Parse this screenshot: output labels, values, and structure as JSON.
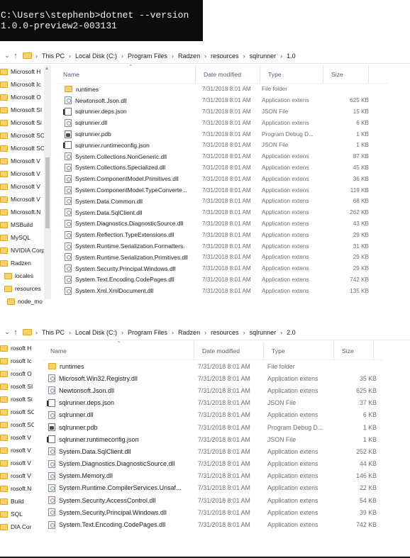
{
  "console": {
    "line1": "C:\\Users\\stephenb>dotnet --version",
    "line2": "1.0.0-preview2-003131"
  },
  "explorer1": {
    "breadcrumb": [
      "This PC",
      "Local Disk (C:)",
      "Program Files",
      "Radzen",
      "resources",
      "sqlrunner",
      "1.0"
    ],
    "nav": [
      "Microsoft H",
      "Microsoft Ic",
      "Microsoft O",
      "Microsoft SI",
      "Microsoft Si",
      "Microsoft SC",
      "Microsoft SC",
      "Microsoft V",
      "Microsoft V",
      "Microsoft V",
      "Microsoft V",
      "Microsoft.N",
      "MSBuild",
      "MySQL",
      "NVIDIA Corp",
      "Radzen",
      "locales",
      "resources",
      "node_mo"
    ],
    "columns": {
      "name": "Name",
      "date": "Date modified",
      "type": "Type",
      "size": "Size"
    },
    "files": [
      {
        "icon": "folder",
        "name": "runtimes",
        "date": "7/31/2018 8:01 AM",
        "type": "File folder",
        "size": ""
      },
      {
        "icon": "dll",
        "name": "Newtonsoft.Json.dll",
        "date": "7/31/2018 8:01 AM",
        "type": "Application extens",
        "size": "625 KB"
      },
      {
        "icon": "json",
        "name": "sqlrunner.deps.json",
        "date": "7/31/2018 8:01 AM",
        "type": "JSON File",
        "size": "15 KB"
      },
      {
        "icon": "dll",
        "name": "sqlrunner.dll",
        "date": "7/31/2018 8:01 AM",
        "type": "Application extens",
        "size": "6 KB"
      },
      {
        "icon": "pdb",
        "name": "sqlrunner.pdb",
        "date": "7/31/2018 8:01 AM",
        "type": "Program Debug D...",
        "size": "1 KB"
      },
      {
        "icon": "json",
        "name": "sqlrunner.runtimeconfig.json",
        "date": "7/31/2018 8:01 AM",
        "type": "JSON File",
        "size": "1 KB"
      },
      {
        "icon": "dll",
        "name": "System.Collections.NonGeneric.dll",
        "date": "7/31/2018 8:01 AM",
        "type": "Application extens",
        "size": "87 KB"
      },
      {
        "icon": "dll",
        "name": "System.Collections.Specialized.dll",
        "date": "7/31/2018 8:01 AM",
        "type": "Application extens",
        "size": "45 KB"
      },
      {
        "icon": "dll",
        "name": "System.ComponentModel.Primitives.dll",
        "date": "7/31/2018 8:01 AM",
        "type": "Application extens",
        "size": "36 KB"
      },
      {
        "icon": "dll",
        "name": "System.ComponentModel.TypeConverte...",
        "date": "7/31/2018 8:01 AM",
        "type": "Application extens",
        "size": "119 KB"
      },
      {
        "icon": "dll",
        "name": "System.Data.Common.dll",
        "date": "7/31/2018 8:01 AM",
        "type": "Application extens",
        "size": "68 KB"
      },
      {
        "icon": "dll",
        "name": "System.Data.SqlClient.dll",
        "date": "7/31/2018 8:01 AM",
        "type": "Application extens",
        "size": "262 KB"
      },
      {
        "icon": "dll",
        "name": "System.Diagnostics.DiagnosticSource.dll",
        "date": "7/31/2018 8:01 AM",
        "type": "Application extens",
        "size": "43 KB"
      },
      {
        "icon": "dll",
        "name": "System.Reflection.TypeExtensions.dll",
        "date": "7/31/2018 8:01 AM",
        "type": "Application extens",
        "size": "29 KB"
      },
      {
        "icon": "dll",
        "name": "System.Runtime.Serialization.Formatters.",
        "date": "7/31/2018 8:01 AM",
        "type": "Application extens",
        "size": "31 KB"
      },
      {
        "icon": "dll",
        "name": "System.Runtime.Serialization.Primitives.dll",
        "date": "7/31/2018 8:01 AM",
        "type": "Application extens",
        "size": "29 KB"
      },
      {
        "icon": "dll",
        "name": "System.Security.Principal.Windows.dll",
        "date": "7/31/2018 8:01 AM",
        "type": "Application extens",
        "size": "29 KB"
      },
      {
        "icon": "dll",
        "name": "System.Text.Encoding.CodePages.dll",
        "date": "7/31/2018 8:01 AM",
        "type": "Application extens",
        "size": "742 KB"
      },
      {
        "icon": "dll",
        "name": "System.Xml.XmlDocument.dll",
        "date": "7/31/2018 8:01 AM",
        "type": "Application extens",
        "size": "135 KB"
      }
    ]
  },
  "explorer2": {
    "breadcrumb": [
      "This PC",
      "Local Disk (C:)",
      "Program Files",
      "Radzen",
      "resources",
      "sqlrunner",
      "2.0"
    ],
    "nav": [
      "rosoft H",
      "rosoft Ic",
      "rosoft O",
      "rosoft SI",
      "rosoft Si",
      "rosoft SC",
      "rosoft SC",
      "rosoft V",
      "rosoft V",
      "rosoft V",
      "rosoft V",
      "rosoft.N",
      "Build",
      "SQL",
      "DIA Cor"
    ],
    "columns": {
      "name": "Name",
      "date": "Date modified",
      "type": "Type",
      "size": "Size"
    },
    "files": [
      {
        "icon": "folder",
        "name": "runtimes",
        "date": "7/31/2018 8:01 AM",
        "type": "File folder",
        "size": ""
      },
      {
        "icon": "dll",
        "name": "Microsoft.Win32.Registry.dll",
        "date": "7/31/2018 8:01 AM",
        "type": "Application extens",
        "size": "35 KB"
      },
      {
        "icon": "dll",
        "name": "Newtonsoft.Json.dll",
        "date": "7/31/2018 8:01 AM",
        "type": "Application extens",
        "size": "625 KB"
      },
      {
        "icon": "json",
        "name": "sqlrunner.deps.json",
        "date": "7/31/2018 8:01 AM",
        "type": "JSON File",
        "size": "37 KB"
      },
      {
        "icon": "dll",
        "name": "sqlrunner.dll",
        "date": "7/31/2018 8:01 AM",
        "type": "Application extens",
        "size": "6 KB"
      },
      {
        "icon": "pdb",
        "name": "sqlrunner.pdb",
        "date": "7/31/2018 8:01 AM",
        "type": "Program Debug D...",
        "size": "1 KB"
      },
      {
        "icon": "json",
        "name": "sqlrunner.runtimeconfig.json",
        "date": "7/31/2018 8:01 AM",
        "type": "JSON File",
        "size": "1 KB"
      },
      {
        "icon": "dll",
        "name": "System.Data.SqlClient.dll",
        "date": "7/31/2018 8:01 AM",
        "type": "Application extens",
        "size": "252 KB"
      },
      {
        "icon": "dll",
        "name": "System.Diagnostics.DiagnosticSource.dll",
        "date": "7/31/2018 8:01 AM",
        "type": "Application extens",
        "size": "44 KB"
      },
      {
        "icon": "dll",
        "name": "System.Memory.dll",
        "date": "7/31/2018 8:01 AM",
        "type": "Application extens",
        "size": "146 KB"
      },
      {
        "icon": "dll",
        "name": "System.Runtime.CompilerServices.Unsaf...",
        "date": "7/31/2018 8:01 AM",
        "type": "Application extens",
        "size": "22 KB"
      },
      {
        "icon": "dll",
        "name": "System.Security.AccessControl.dll",
        "date": "7/31/2018 8:01 AM",
        "type": "Application extens",
        "size": "54 KB"
      },
      {
        "icon": "dll",
        "name": "System.Security.Principal.Windows.dll",
        "date": "7/31/2018 8:01 AM",
        "type": "Application extens",
        "size": "39 KB"
      },
      {
        "icon": "dll",
        "name": "System.Text.Encoding.CodePages.dll",
        "date": "7/31/2018 8:01 AM",
        "type": "Application extens",
        "size": "742 KB"
      }
    ]
  }
}
